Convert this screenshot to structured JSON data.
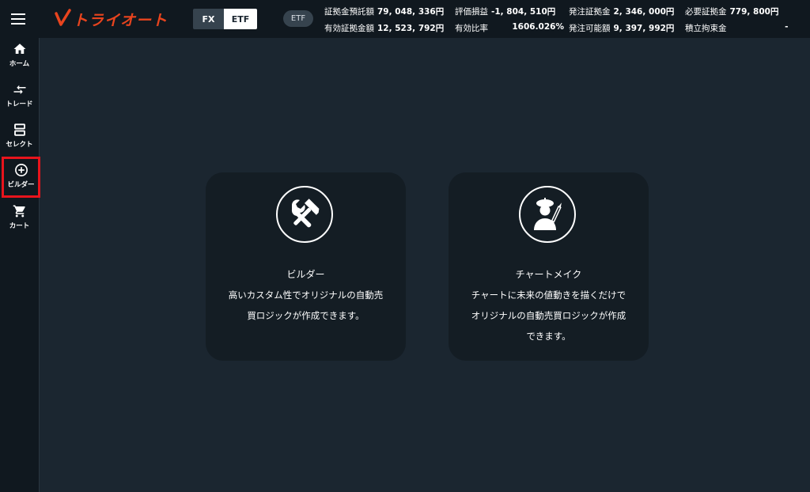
{
  "header": {
    "logo_text": "トライオート",
    "segments": [
      "FX",
      "ETF"
    ],
    "selected_segment": "ETF",
    "product_pill": "ETF",
    "stats": [
      {
        "label": "証拠金預託額",
        "value": "79, 048, 336円"
      },
      {
        "label": "評価損益",
        "value": "-1, 804, 510円"
      },
      {
        "label": "発注証拠金",
        "value": "2, 346, 000円"
      },
      {
        "label": "必要証拠金",
        "value": "779, 800円"
      },
      {
        "label": "有効証拠金額",
        "value": "12, 523, 792円"
      },
      {
        "label": "有効比率",
        "value": "1606.026%"
      },
      {
        "label": "発注可能額",
        "value": "9, 397, 992円"
      },
      {
        "label": "積立拘束金",
        "value": "-"
      }
    ]
  },
  "sidebar": {
    "items": [
      {
        "label": "ホーム",
        "icon": "home-icon"
      },
      {
        "label": "トレード",
        "icon": "trade-arrows-icon"
      },
      {
        "label": "セレクト",
        "icon": "select-icon"
      },
      {
        "label": "ビルダー",
        "icon": "plus-circle-icon"
      },
      {
        "label": "カート",
        "icon": "cart-icon"
      }
    ],
    "active": "ビルダー",
    "active_color": "#e8141c"
  },
  "cards": [
    {
      "title": "ビルダー",
      "description": [
        "高いカスタム性でオリジナルの自動売",
        "買ロジックが作成できます。"
      ],
      "icon": "tools-icon"
    },
    {
      "title": "チャートメイク",
      "description": [
        "チャートに未来の値動きを描くだけで",
        "オリジナルの自動売買ロジックが作成",
        "できます。"
      ],
      "icon": "artist-icon"
    }
  ],
  "colors": {
    "background": "#1b2630",
    "bar": "#10181f",
    "card": "#141d24",
    "brand": "#e8441e"
  }
}
